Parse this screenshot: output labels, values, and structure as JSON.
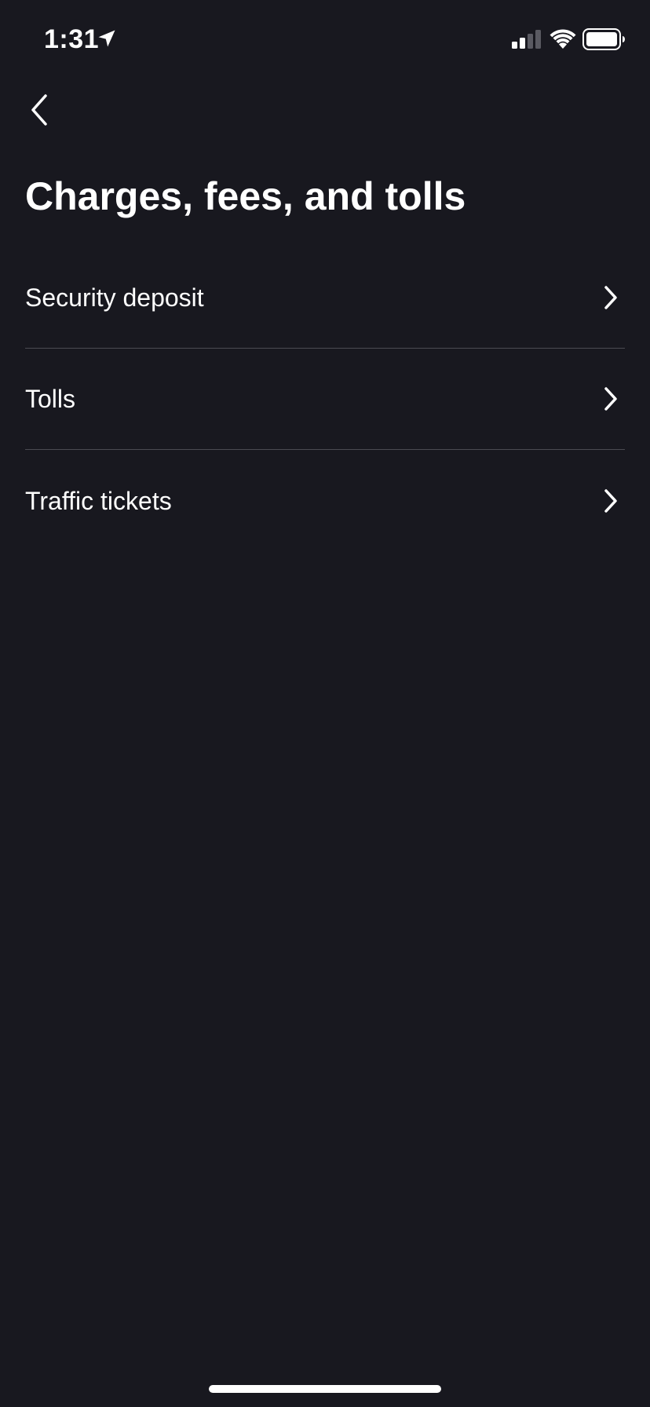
{
  "status_bar": {
    "time": "1:31",
    "icons": [
      "location-arrow-icon",
      "cellular-signal-icon",
      "wifi-icon",
      "battery-icon"
    ]
  },
  "nav": {
    "back_icon": "chevron-left-icon"
  },
  "page": {
    "title": "Charges, fees, and tolls"
  },
  "menu": {
    "items": [
      {
        "label": "Security deposit",
        "icon": "chevron-right-icon"
      },
      {
        "label": "Tolls",
        "icon": "chevron-right-icon"
      },
      {
        "label": "Traffic tickets",
        "icon": "chevron-right-icon"
      }
    ]
  },
  "colors": {
    "background": "#18181f",
    "text": "#ffffff",
    "divider": "#4a4a52"
  }
}
